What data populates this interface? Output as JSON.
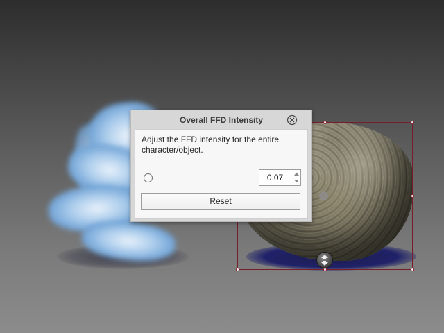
{
  "dialog": {
    "title": "Overall FFD Intensity",
    "close_icon": "close-circle-icon",
    "description": "Adjust the FFD intensity for the entire character/object.",
    "intensity": {
      "value": "0.07",
      "slider_fraction": 0.0
    },
    "reset_label": "Reset"
  },
  "viewport": {
    "selection_color": "#7a1d2a",
    "gizmo_icon": "move-arrows-icon"
  }
}
